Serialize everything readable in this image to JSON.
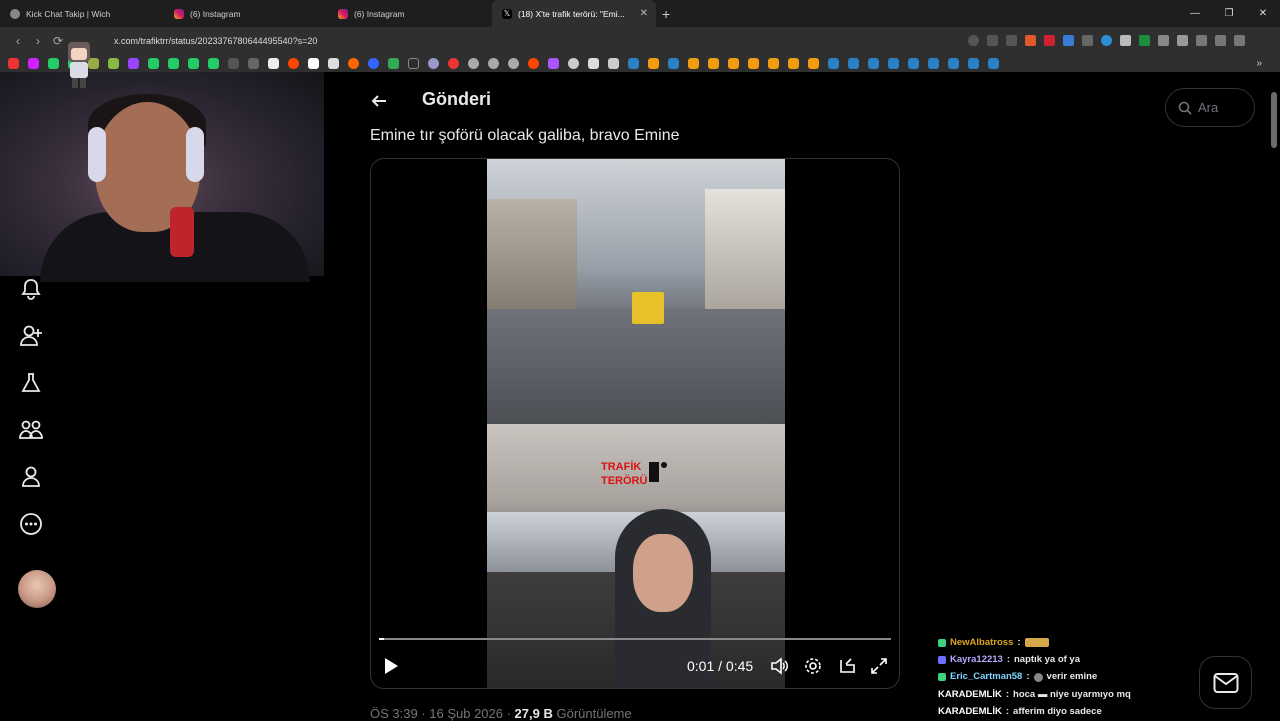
{
  "browser": {
    "tabs": [
      {
        "label": "Kick Chat Takip | Wich",
        "active": false
      },
      {
        "label": "(6) Instagram",
        "active": false
      },
      {
        "label": "(6) Instagram",
        "active": false
      },
      {
        "label": "(18) X'te trafik terörü: \"Emi...",
        "active": true
      }
    ],
    "url": "x.com/trafiktrr/status/2023376780644495540?s=20"
  },
  "post": {
    "header_title": "Gönderi",
    "search_placeholder": "Ara",
    "text": "Emine tır şoförü olacak galiba, bravo Emine",
    "video_time": "0:01 / 0:45",
    "video_progress": 0.01,
    "watermark_line1": "TRAFİK",
    "watermark_line2": "TERÖRÜ",
    "meta_time": "ÖS 3:39 · 16 Şub 2026 · ",
    "meta_views_count": "27,9 B",
    "meta_views_label": " Görüntüleme"
  },
  "chat": {
    "messages": [
      {
        "user": "NewAlbatross",
        "text": "",
        "color": "#d9a51e"
      },
      {
        "user": "Kayra12213",
        "text": "naptık ya of ya",
        "color": "#b9a8ff"
      },
      {
        "user": "Eric_Cartman58",
        "text": "verir emine",
        "color": "#7fd3ff"
      },
      {
        "user": "KARADEMLİK",
        "text": "hoca ▬ niye uyarmıyo mq",
        "color": "#ffffff"
      },
      {
        "user": "KARADEMLİK",
        "text": "afferim diyo sadece",
        "color": "#ffffff"
      }
    ]
  },
  "colors": {
    "accent": "#1d9bf0",
    "chat_badge_green": "#3bd27d"
  }
}
